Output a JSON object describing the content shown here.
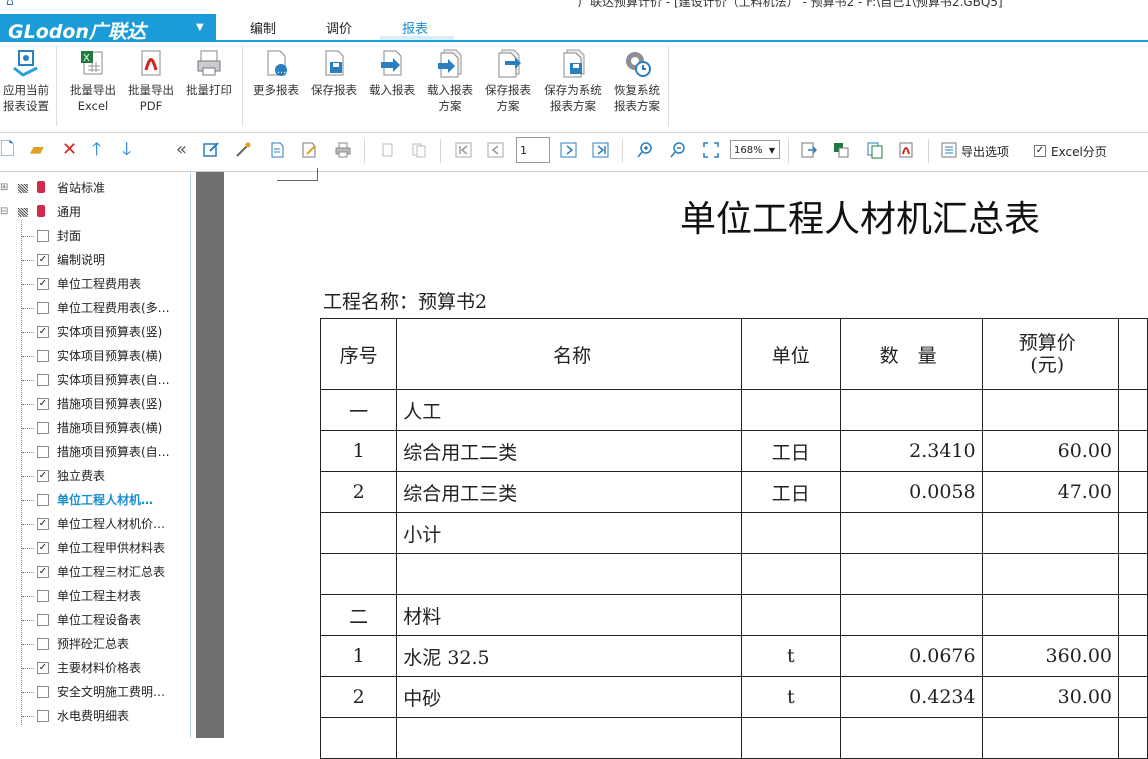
{
  "window": {
    "title": "广联达预算计价 - [建设计价（工料机法） - 预算书2 - F:\\自己1\\预算书2.GBQ5]"
  },
  "logo": {
    "brand": "GLodon广联达",
    "arrow": "▼"
  },
  "menu": [
    {
      "label": "编制"
    },
    {
      "label": "调价"
    },
    {
      "label": "报表"
    }
  ],
  "ribbon": [
    {
      "line1": "应用当前",
      "line2": "报表设置",
      "icon": "apply-settings-icon"
    },
    {
      "line1": "批量导出",
      "line2": "Excel",
      "icon": "excel-export-icon"
    },
    {
      "line1": "批量导出",
      "line2": "PDF",
      "icon": "pdf-export-icon"
    },
    {
      "line1": "批量打印",
      "line2": "",
      "icon": "batch-print-icon"
    },
    {
      "line1": "更多报表",
      "line2": "",
      "icon": "more-reports-icon"
    },
    {
      "line1": "保存报表",
      "line2": "",
      "icon": "save-report-icon"
    },
    {
      "line1": "载入报表",
      "line2": "",
      "icon": "load-report-icon"
    },
    {
      "line1": "载入报表",
      "line2": "方案",
      "icon": "load-scheme-icon"
    },
    {
      "line1": "保存报表",
      "line2": "方案",
      "icon": "save-scheme-icon"
    },
    {
      "line1": "保存为系统",
      "line2": "报表方案",
      "icon": "save-system-scheme-icon"
    },
    {
      "line1": "恢复系统",
      "line2": "报表方案",
      "icon": "restore-system-icon"
    }
  ],
  "toolbar": {
    "page_input": "1",
    "zoom": "168%",
    "export_options": "导出选项",
    "excel_paging": "Excel分页",
    "excel_paging_checked": true
  },
  "tree": {
    "groups": [
      {
        "label": "省站标准",
        "expander": "⊞"
      },
      {
        "label": "通用",
        "expander": "⊟"
      }
    ],
    "items": [
      {
        "label": "封面",
        "checked": false
      },
      {
        "label": "编制说明",
        "checked": true
      },
      {
        "label": "单位工程费用表",
        "checked": true
      },
      {
        "label": "单位工程费用表(多…",
        "checked": false
      },
      {
        "label": "实体项目预算表(竖)",
        "checked": true
      },
      {
        "label": "实体项目预算表(横)",
        "checked": false
      },
      {
        "label": "实体项目预算表(自…",
        "checked": false
      },
      {
        "label": "措施项目预算表(竖)",
        "checked": true
      },
      {
        "label": "措施项目预算表(横)",
        "checked": false
      },
      {
        "label": "措施项目预算表(自…",
        "checked": false
      },
      {
        "label": "独立费表",
        "checked": true
      },
      {
        "label": "单位工程人材机…",
        "checked": false,
        "selected": true
      },
      {
        "label": "单位工程人材机价…",
        "checked": true
      },
      {
        "label": "单位工程甲供材料表",
        "checked": true
      },
      {
        "label": "单位工程三材汇总表",
        "checked": true
      },
      {
        "label": "单位工程主材表",
        "checked": false
      },
      {
        "label": "单位工程设备表",
        "checked": false
      },
      {
        "label": "预拌砼汇总表",
        "checked": false
      },
      {
        "label": "主要材料价格表",
        "checked": true
      },
      {
        "label": "安全文明施工费明…",
        "checked": false
      },
      {
        "label": "水电费明细表",
        "checked": false
      }
    ]
  },
  "report": {
    "title": "单位工程人材机汇总表",
    "project_name": "工程名称：预算书2",
    "headers": {
      "seq": "序号",
      "name": "名称",
      "unit": "单位",
      "qty": "数　量",
      "price_l1": "预算价",
      "price_l2": "(元)"
    },
    "rows": [
      {
        "seq": "一",
        "name": "人工",
        "unit": "",
        "qty": "",
        "price": ""
      },
      {
        "seq": "1",
        "name": "综合用工二类",
        "unit": "工日",
        "qty": "2.3410",
        "price": "60.00"
      },
      {
        "seq": "2",
        "name": "综合用工三类",
        "unit": "工日",
        "qty": "0.0058",
        "price": "47.00"
      },
      {
        "seq": "",
        "name": "小计",
        "unit": "",
        "qty": "",
        "price": ""
      },
      {
        "seq": "",
        "name": "",
        "unit": "",
        "qty": "",
        "price": ""
      },
      {
        "seq": "二",
        "name": "材料",
        "unit": "",
        "qty": "",
        "price": ""
      },
      {
        "seq": "1",
        "name": "水泥 32.5",
        "unit": "t",
        "qty": "0.0676",
        "price": "360.00"
      },
      {
        "seq": "2",
        "name": "中砂",
        "unit": "t",
        "qty": "0.4234",
        "price": "30.00"
      },
      {
        "seq": "",
        "name": "",
        "unit": "",
        "qty": "",
        "price": ""
      }
    ]
  },
  "colors": {
    "accent": "#1b9bd7",
    "selected_text": "#1b8fd0",
    "gutter": "#6f6f6f"
  }
}
